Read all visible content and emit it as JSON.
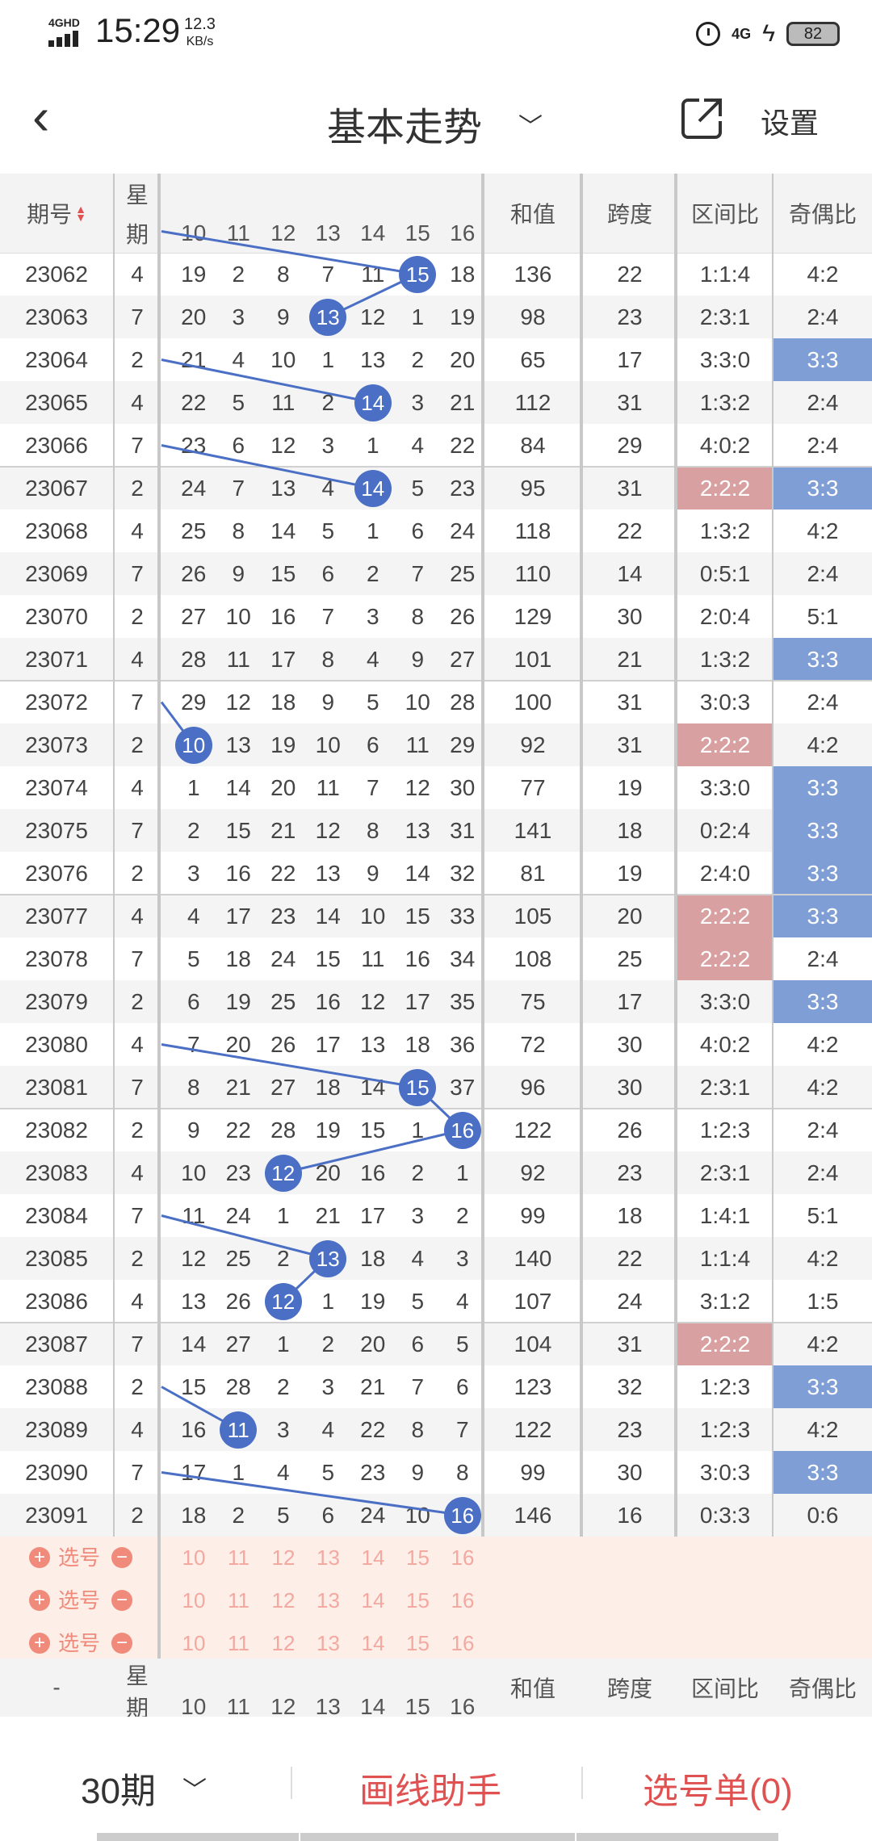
{
  "status_bar": {
    "network": "4GHD",
    "time": "15:29",
    "speed_value": "12.3",
    "speed_unit": "KB/s",
    "lte": "4G",
    "battery": "82"
  },
  "nav": {
    "title": "基本走势",
    "settings_label": "设置"
  },
  "table": {
    "headers": {
      "period": "期号",
      "week_top": "星",
      "week_bottom": "期",
      "sum": "和值",
      "span": "跨度",
      "interval": "区间比",
      "odd_even": "奇偶比",
      "numbers": [
        "10",
        "11",
        "12",
        "13",
        "14",
        "15",
        "16"
      ]
    },
    "rows": [
      {
        "period": "23062",
        "week": "4",
        "nums": [
          "19",
          "2",
          "8",
          "7",
          "11",
          "15",
          "18"
        ],
        "ball": 15,
        "sum": "136",
        "span": "22",
        "interval": "1:1:4",
        "oe": "4:2",
        "interval_hl": false,
        "oe_hl": false
      },
      {
        "period": "23063",
        "week": "7",
        "nums": [
          "20",
          "3",
          "9",
          "13",
          "12",
          "1",
          "19"
        ],
        "ball": 13,
        "sum": "98",
        "span": "23",
        "interval": "2:3:1",
        "oe": "2:4",
        "interval_hl": false,
        "oe_hl": false
      },
      {
        "period": "23064",
        "week": "2",
        "nums": [
          "21",
          "4",
          "10",
          "1",
          "13",
          "2",
          "20"
        ],
        "ball": null,
        "sum": "65",
        "span": "17",
        "interval": "3:3:0",
        "oe": "3:3",
        "interval_hl": false,
        "oe_hl": true
      },
      {
        "period": "23065",
        "week": "4",
        "nums": [
          "22",
          "5",
          "11",
          "2",
          "14",
          "3",
          "21"
        ],
        "ball": 14,
        "sum": "112",
        "span": "31",
        "interval": "1:3:2",
        "oe": "2:4",
        "interval_hl": false,
        "oe_hl": false
      },
      {
        "period": "23066",
        "week": "7",
        "nums": [
          "23",
          "6",
          "12",
          "3",
          "1",
          "4",
          "22"
        ],
        "ball": null,
        "sum": "84",
        "span": "29",
        "interval": "4:0:2",
        "oe": "2:4",
        "interval_hl": false,
        "oe_hl": false
      },
      {
        "period": "23067",
        "week": "2",
        "nums": [
          "24",
          "7",
          "13",
          "4",
          "14",
          "5",
          "23"
        ],
        "ball": 14,
        "sum": "95",
        "span": "31",
        "interval": "2:2:2",
        "oe": "3:3",
        "interval_hl": true,
        "oe_hl": true
      },
      {
        "period": "23068",
        "week": "4",
        "nums": [
          "25",
          "8",
          "14",
          "5",
          "1",
          "6",
          "24"
        ],
        "ball": null,
        "sum": "118",
        "span": "22",
        "interval": "1:3:2",
        "oe": "4:2",
        "interval_hl": false,
        "oe_hl": false
      },
      {
        "period": "23069",
        "week": "7",
        "nums": [
          "26",
          "9",
          "15",
          "6",
          "2",
          "7",
          "25"
        ],
        "ball": null,
        "sum": "110",
        "span": "14",
        "interval": "0:5:1",
        "oe": "2:4",
        "interval_hl": false,
        "oe_hl": false
      },
      {
        "period": "23070",
        "week": "2",
        "nums": [
          "27",
          "10",
          "16",
          "7",
          "3",
          "8",
          "26"
        ],
        "ball": null,
        "sum": "129",
        "span": "30",
        "interval": "2:0:4",
        "oe": "5:1",
        "interval_hl": false,
        "oe_hl": false
      },
      {
        "period": "23071",
        "week": "4",
        "nums": [
          "28",
          "11",
          "17",
          "8",
          "4",
          "9",
          "27"
        ],
        "ball": null,
        "sum": "101",
        "span": "21",
        "interval": "1:3:2",
        "oe": "3:3",
        "interval_hl": false,
        "oe_hl": true
      },
      {
        "period": "23072",
        "week": "7",
        "nums": [
          "29",
          "12",
          "18",
          "9",
          "5",
          "10",
          "28"
        ],
        "ball": null,
        "sum": "100",
        "span": "31",
        "interval": "3:0:3",
        "oe": "2:4",
        "interval_hl": false,
        "oe_hl": false
      },
      {
        "period": "23073",
        "week": "2",
        "nums": [
          "10",
          "13",
          "19",
          "10",
          "6",
          "11",
          "29"
        ],
        "ball": 10,
        "sum": "92",
        "span": "31",
        "interval": "2:2:2",
        "oe": "4:2",
        "interval_hl": true,
        "oe_hl": false
      },
      {
        "period": "23074",
        "week": "4",
        "nums": [
          "1",
          "14",
          "20",
          "11",
          "7",
          "12",
          "30"
        ],
        "ball": null,
        "sum": "77",
        "span": "19",
        "interval": "3:3:0",
        "oe": "3:3",
        "interval_hl": false,
        "oe_hl": true
      },
      {
        "period": "23075",
        "week": "7",
        "nums": [
          "2",
          "15",
          "21",
          "12",
          "8",
          "13",
          "31"
        ],
        "ball": null,
        "sum": "141",
        "span": "18",
        "interval": "0:2:4",
        "oe": "3:3",
        "interval_hl": false,
        "oe_hl": true
      },
      {
        "period": "23076",
        "week": "2",
        "nums": [
          "3",
          "16",
          "22",
          "13",
          "9",
          "14",
          "32"
        ],
        "ball": null,
        "sum": "81",
        "span": "19",
        "interval": "2:4:0",
        "oe": "3:3",
        "interval_hl": false,
        "oe_hl": true
      },
      {
        "period": "23077",
        "week": "4",
        "nums": [
          "4",
          "17",
          "23",
          "14",
          "10",
          "15",
          "33"
        ],
        "ball": null,
        "sum": "105",
        "span": "20",
        "interval": "2:2:2",
        "oe": "3:3",
        "interval_hl": true,
        "oe_hl": true
      },
      {
        "period": "23078",
        "week": "7",
        "nums": [
          "5",
          "18",
          "24",
          "15",
          "11",
          "16",
          "34"
        ],
        "ball": null,
        "sum": "108",
        "span": "25",
        "interval": "2:2:2",
        "oe": "2:4",
        "interval_hl": true,
        "oe_hl": false
      },
      {
        "period": "23079",
        "week": "2",
        "nums": [
          "6",
          "19",
          "25",
          "16",
          "12",
          "17",
          "35"
        ],
        "ball": null,
        "sum": "75",
        "span": "17",
        "interval": "3:3:0",
        "oe": "3:3",
        "interval_hl": false,
        "oe_hl": true
      },
      {
        "period": "23080",
        "week": "4",
        "nums": [
          "7",
          "20",
          "26",
          "17",
          "13",
          "18",
          "36"
        ],
        "ball": null,
        "sum": "72",
        "span": "30",
        "interval": "4:0:2",
        "oe": "4:2",
        "interval_hl": false,
        "oe_hl": false
      },
      {
        "period": "23081",
        "week": "7",
        "nums": [
          "8",
          "21",
          "27",
          "18",
          "14",
          "15",
          "37"
        ],
        "ball": 15,
        "sum": "96",
        "span": "30",
        "interval": "2:3:1",
        "oe": "4:2",
        "interval_hl": false,
        "oe_hl": false
      },
      {
        "period": "23082",
        "week": "2",
        "nums": [
          "9",
          "22",
          "28",
          "19",
          "15",
          "1",
          "16"
        ],
        "ball": 16,
        "sum": "122",
        "span": "26",
        "interval": "1:2:3",
        "oe": "2:4",
        "interval_hl": false,
        "oe_hl": false
      },
      {
        "period": "23083",
        "week": "4",
        "nums": [
          "10",
          "23",
          "12",
          "20",
          "16",
          "2",
          "1"
        ],
        "ball": 12,
        "sum": "92",
        "span": "23",
        "interval": "2:3:1",
        "oe": "2:4",
        "interval_hl": false,
        "oe_hl": false
      },
      {
        "period": "23084",
        "week": "7",
        "nums": [
          "11",
          "24",
          "1",
          "21",
          "17",
          "3",
          "2"
        ],
        "ball": null,
        "sum": "99",
        "span": "18",
        "interval": "1:4:1",
        "oe": "5:1",
        "interval_hl": false,
        "oe_hl": false
      },
      {
        "period": "23085",
        "week": "2",
        "nums": [
          "12",
          "25",
          "2",
          "13",
          "18",
          "4",
          "3"
        ],
        "ball": 13,
        "sum": "140",
        "span": "22",
        "interval": "1:1:4",
        "oe": "4:2",
        "interval_hl": false,
        "oe_hl": false
      },
      {
        "period": "23086",
        "week": "4",
        "nums": [
          "13",
          "26",
          "12",
          "1",
          "19",
          "5",
          "4"
        ],
        "ball": 12,
        "sum": "107",
        "span": "24",
        "interval": "3:1:2",
        "oe": "1:5",
        "interval_hl": false,
        "oe_hl": false
      },
      {
        "period": "23087",
        "week": "7",
        "nums": [
          "14",
          "27",
          "1",
          "2",
          "20",
          "6",
          "5"
        ],
        "ball": null,
        "sum": "104",
        "span": "31",
        "interval": "2:2:2",
        "oe": "4:2",
        "interval_hl": true,
        "oe_hl": false
      },
      {
        "period": "23088",
        "week": "2",
        "nums": [
          "15",
          "28",
          "2",
          "3",
          "21",
          "7",
          "6"
        ],
        "ball": null,
        "sum": "123",
        "span": "32",
        "interval": "1:2:3",
        "oe": "3:3",
        "interval_hl": false,
        "oe_hl": true
      },
      {
        "period": "23089",
        "week": "4",
        "nums": [
          "16",
          "11",
          "3",
          "4",
          "22",
          "8",
          "7"
        ],
        "ball": 11,
        "sum": "122",
        "span": "23",
        "interval": "1:2:3",
        "oe": "4:2",
        "interval_hl": false,
        "oe_hl": false
      },
      {
        "period": "23090",
        "week": "7",
        "nums": [
          "17",
          "1",
          "4",
          "5",
          "23",
          "9",
          "8"
        ],
        "ball": null,
        "sum": "99",
        "span": "30",
        "interval": "3:0:3",
        "oe": "3:3",
        "interval_hl": false,
        "oe_hl": true
      },
      {
        "period": "23091",
        "week": "2",
        "nums": [
          "18",
          "2",
          "5",
          "6",
          "24",
          "10",
          "16"
        ],
        "ball": 16,
        "sum": "146",
        "span": "16",
        "interval": "0:3:3",
        "oe": "0:6",
        "interval_hl": false,
        "oe_hl": false
      }
    ],
    "select_rows": [
      {
        "label": "选号",
        "nums": [
          "10",
          "11",
          "12",
          "13",
          "14",
          "15",
          "16"
        ]
      },
      {
        "label": "选号",
        "nums": [
          "10",
          "11",
          "12",
          "13",
          "14",
          "15",
          "16"
        ]
      },
      {
        "label": "选号",
        "nums": [
          "10",
          "11",
          "12",
          "13",
          "14",
          "15",
          "16"
        ]
      }
    ],
    "footer_headers": {
      "period": "-",
      "week_top": "星",
      "week_bottom": "期",
      "sum": "和值",
      "span": "跨度",
      "interval": "区间比",
      "odd_even": "奇偶比",
      "numbers": [
        "10",
        "11",
        "12",
        "13",
        "14",
        "15",
        "16"
      ]
    }
  },
  "bottom_bar": {
    "period_select": "30期",
    "draw_helper": "画线助手",
    "pick_list": "选号单(0)"
  },
  "colors": {
    "ball": "#4a6fc5",
    "interval_highlight": "#d9a0a2",
    "odd_even_highlight": "#7f9ed6",
    "accent": "#e05252"
  }
}
